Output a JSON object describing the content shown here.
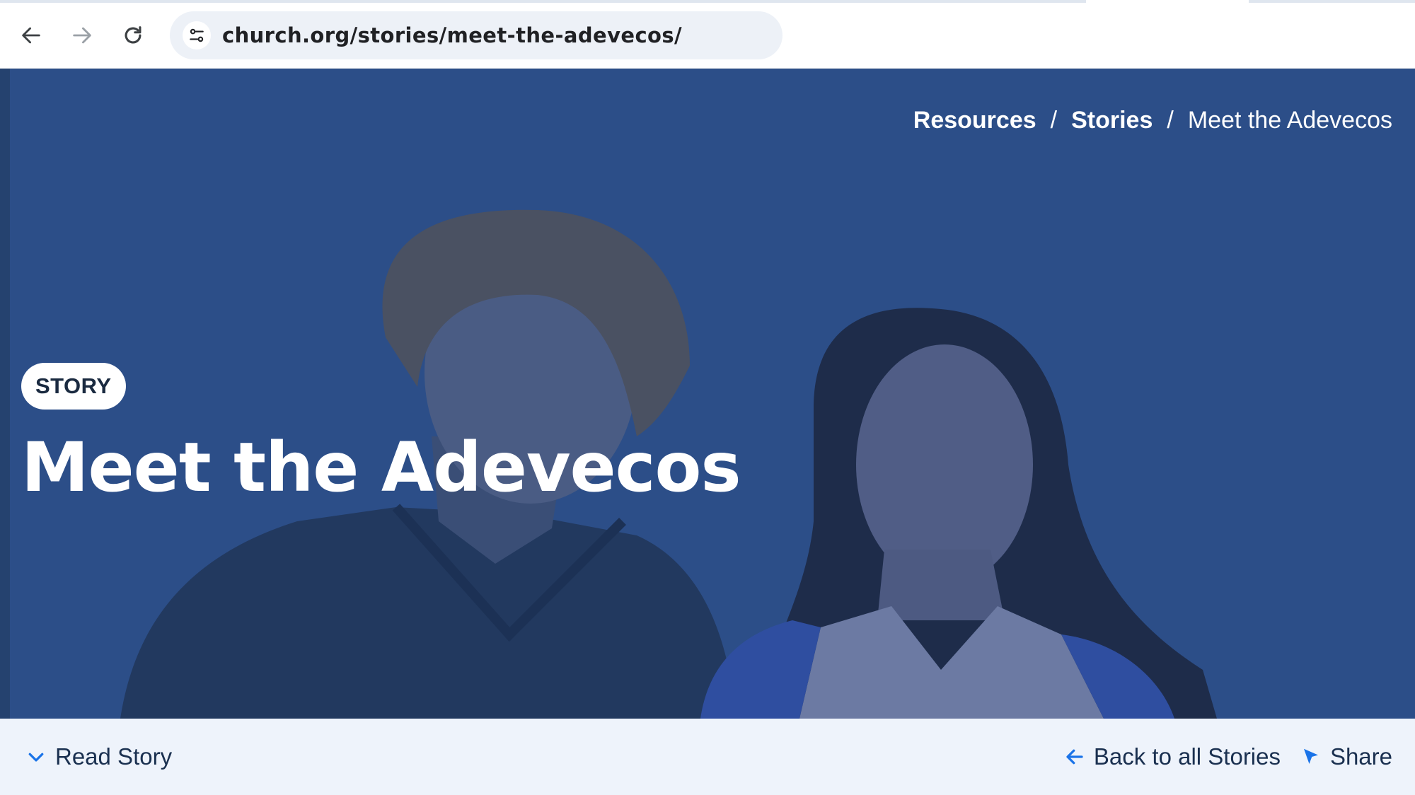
{
  "browser": {
    "url": "church.org/stories/meet-the-adevecos/",
    "icons": [
      "back-arrow-icon",
      "forward-arrow-icon",
      "reload-icon",
      "site-settings-icon"
    ]
  },
  "breadcrumb": {
    "items": [
      {
        "label": "Resources",
        "link": true
      },
      {
        "label": "Stories",
        "link": true
      },
      {
        "label": "Meet the Adevecos",
        "link": false
      }
    ],
    "separator": "/"
  },
  "hero": {
    "badge": "STORY",
    "title": "Meet the Adevecos"
  },
  "actions": {
    "read_story": "Read Story",
    "back": "Back to all Stories",
    "share": "Share"
  },
  "colors": {
    "overlay_blue": "#2b4c85",
    "accent_blue": "#1a73e8",
    "action_bar_bg": "#eef3fb"
  }
}
